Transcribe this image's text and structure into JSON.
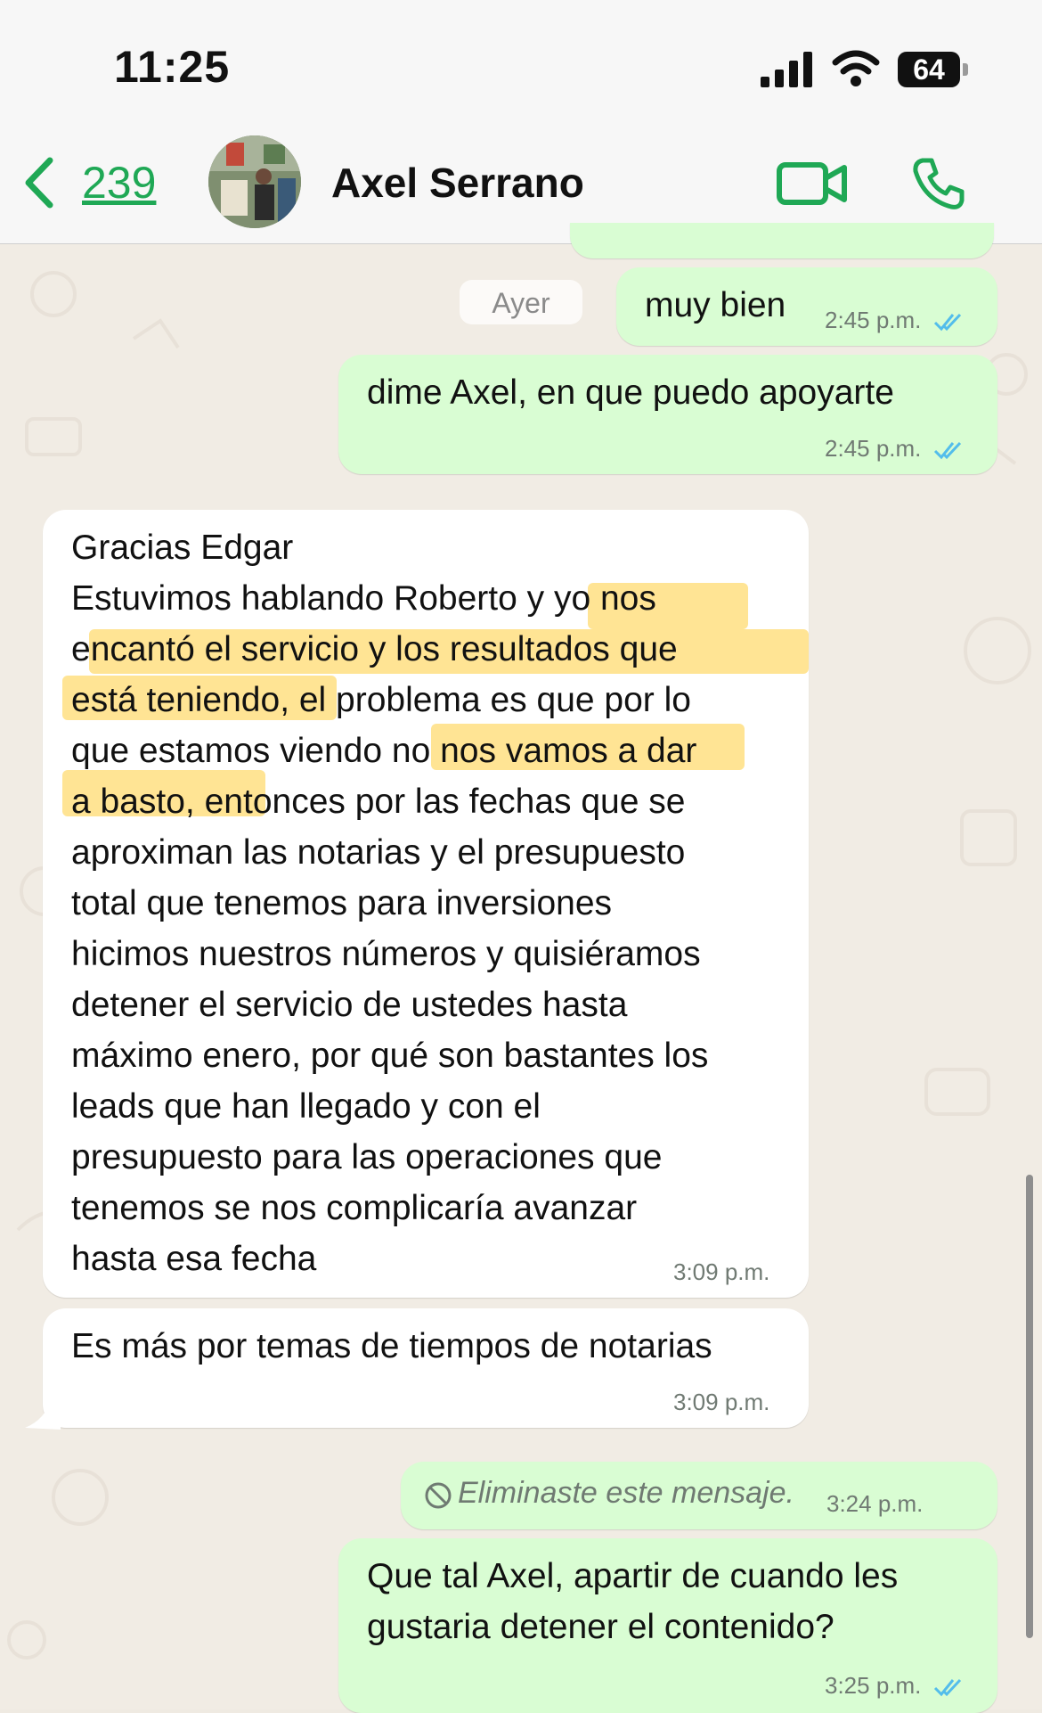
{
  "status_bar": {
    "time": "11:25",
    "battery": "64"
  },
  "header": {
    "back_count": "239",
    "contact_name": "Axel Serrano"
  },
  "date_separator": "Ayer",
  "messages": [
    {
      "direction": "out",
      "text": "muy bien",
      "time": "2:45 p.m.",
      "read": true
    },
    {
      "direction": "out",
      "text": "dime Axel, en que puedo apoyarte",
      "time": "2:45 p.m.",
      "read": true
    },
    {
      "direction": "in",
      "text": "Gracias Edgar\nEstuvimos hablando Roberto y yo nos\nencantó el servicio y los resultados que\nestá teniendo, el problema es que por lo\nque estamos viendo no nos vamos a dar\na basto, entonces por las fechas que se\naproximan las notarias y el presupuesto\ntotal que tenemos para inversiones\nhicimos nuestros números y quisiéramos\ndetener el servicio de ustedes hasta\nmáximo enero, por qué son bastantes los\nleads que han llegado y con el\npresupuesto para las operaciones que\ntenemos se nos complicaría avanzar\nhasta esa fecha",
      "time": "3:09 p.m."
    },
    {
      "direction": "in",
      "text": "Es más por temas de tiempos de notarias",
      "time": "3:09 p.m."
    },
    {
      "direction": "out",
      "text": "Eliminaste este mensaje.",
      "time": "3:24 p.m.",
      "deleted": true
    },
    {
      "direction": "out",
      "text": "Que tal Axel, apartir de cuando les\ngustaria detener el contenido?",
      "time": "3:25 p.m.",
      "read": true
    }
  ],
  "colors": {
    "accent": "#1fa855",
    "outgoing_bubble": "#d9fdd3",
    "incoming_bubble": "#ffffff",
    "read_ticks": "#53bdeb",
    "highlight": "#ffd966"
  },
  "icons": [
    "back-chevron-icon",
    "video-call-icon",
    "phone-call-icon",
    "double-check-icon",
    "deleted-message-icon",
    "signal-icon",
    "wifi-icon",
    "battery-icon"
  ]
}
